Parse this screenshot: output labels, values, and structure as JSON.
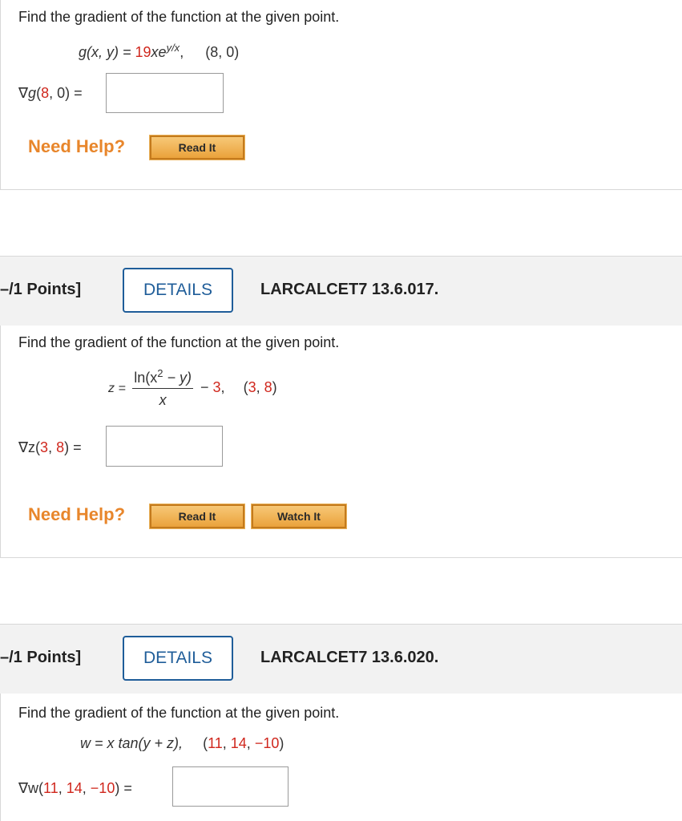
{
  "q1": {
    "prompt": "Find the gradient of the function at the given point.",
    "func_lhs": "g(x, y) = ",
    "func_rhs_coeff": "19",
    "func_rhs_var": "xe",
    "func_rhs_exp": "y/x",
    "func_point_open": "(8, 0)",
    "answer_label_nabla": "∇",
    "answer_label_fn": "g",
    "answer_label_open": "(",
    "answer_label_a": "8",
    "answer_label_sep": ", ",
    "answer_label_b": "0",
    "answer_label_close": ") =",
    "answer_value": "",
    "need_help": "Need Help?",
    "read_it": "Read It"
  },
  "q2": {
    "points": "–/1 Points]",
    "details": "DETAILS",
    "id": "LARCALCET7 13.6.017.",
    "prompt": "Find the gradient of the function at the given point.",
    "z_eq": "z = ",
    "num_a": "ln(x",
    "num_exp": "2",
    "num_b": " − y)",
    "den": "x",
    "tail_a": "− ",
    "tail_num": "3",
    "tail_b": ",",
    "pt_open": "(",
    "pt_a": "3",
    "pt_sep": ", ",
    "pt_b": "8",
    "pt_close": ")",
    "answer_label_pre": "∇z(",
    "answer_label_a": "3",
    "answer_label_sep": ", ",
    "answer_label_b": "8",
    "answer_label_close": ") =",
    "answer_value": "",
    "need_help": "Need Help?",
    "read_it": "Read It",
    "watch_it": "Watch It"
  },
  "q3": {
    "points": "–/1 Points]",
    "details": "DETAILS",
    "id": "LARCALCET7 13.6.020.",
    "prompt": "Find the gradient of the function at the given point.",
    "func": "w = x tan(y + z),",
    "pt_open": "(",
    "pt_a": "11",
    "pt_sep1": ", ",
    "pt_b": "14",
    "pt_sep2": ", ",
    "pt_c": "−10",
    "pt_close": ")",
    "answer_label_pre": "∇w(",
    "answer_label_a": "11",
    "answer_label_sep1": ", ",
    "answer_label_b": "14",
    "answer_label_sep2": ", ",
    "answer_label_c": "−10",
    "answer_label_close": ") =",
    "answer_value": ""
  }
}
